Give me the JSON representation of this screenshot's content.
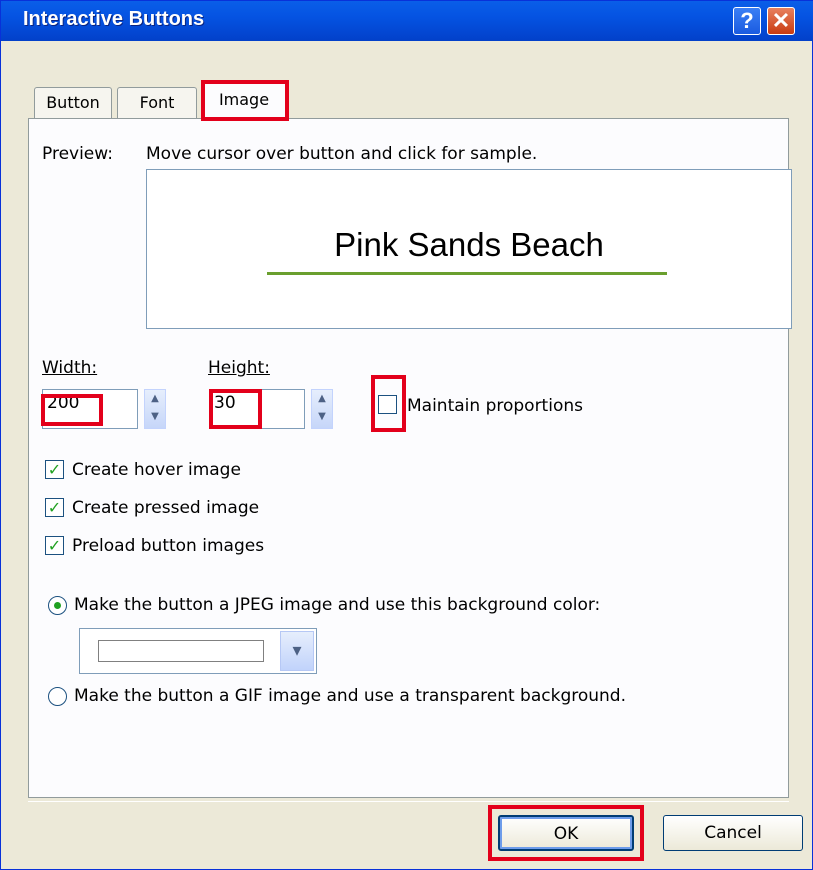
{
  "window": {
    "title": "Interactive Buttons",
    "help_glyph": "?",
    "close_glyph": "✕"
  },
  "tabs": [
    {
      "label": "Button"
    },
    {
      "label": "Font"
    },
    {
      "label": "Image"
    }
  ],
  "preview": {
    "label": "Preview:",
    "instruction": "Move cursor over button and click for sample.",
    "button_text": "Pink Sands Beach",
    "underline_color": "#6a9f2e"
  },
  "size": {
    "width_label": "Width:",
    "width_value": "200",
    "height_label": "Height:",
    "height_value": "30",
    "maintain_label": "Maintain proportions",
    "maintain_checked": false
  },
  "options": [
    {
      "label": "Create hover image",
      "checked": true
    },
    {
      "label": "Create pressed image",
      "checked": true
    },
    {
      "label": "Preload button images",
      "checked": true
    }
  ],
  "background": {
    "jpeg_label": "Make the button a JPEG image and use this background color:",
    "jpeg_selected": true,
    "color_value": "#ffffff",
    "gif_label": "Make the button a GIF image and use a transparent background.",
    "gif_selected": false
  },
  "footer": {
    "ok_label": "OK",
    "cancel_label": "Cancel"
  },
  "colors": {
    "title_bar": "#0553e2",
    "highlight": "#e3001b",
    "check": "#21a121"
  },
  "icons": {
    "help": "help-icon",
    "close": "close-icon",
    "spin": "spin-arrows-icon",
    "dropdown": "chevron-down-icon"
  }
}
